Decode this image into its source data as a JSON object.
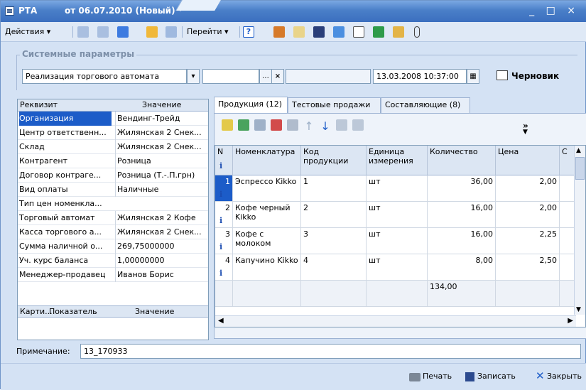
{
  "window": {
    "title_app": "РТА",
    "title_doc": "от 06.07.2010 (Новый) *",
    "controls": "_ □ ×"
  },
  "toolbar": {
    "actions_label": "Действия ▾",
    "goto_label": "Перейти ▾",
    "help_glyph": "?"
  },
  "system_params": {
    "legend": "Системные параметры",
    "operation_type": "Реализация торгового автомата",
    "ellipsis": "...",
    "clear": "×",
    "date_value": "13.03.2008 10:37:00",
    "draft_label": "Черновик"
  },
  "requisites": {
    "headers": [
      "Реквизит",
      "Значение"
    ],
    "rows": [
      [
        "Организация",
        "Вендинг-Трейд"
      ],
      [
        "Центр ответственн...",
        "Жилянская 2 Снек..."
      ],
      [
        "Склад",
        "Жилянская 2 Снек..."
      ],
      [
        "Контрагент",
        "Розница"
      ],
      [
        "Договор контраге...",
        "Розница (Т.-.П.грн)"
      ],
      [
        "Вид оплаты",
        "Наличные"
      ],
      [
        "Тип цен номенкла...",
        ""
      ],
      [
        "Торговый автомат",
        "Жилянская 2 Кофе"
      ],
      [
        "Касса торгового а...",
        "Жилянская 2 Снек..."
      ],
      [
        "Сумма наличной о...",
        "269,75000000"
      ],
      [
        "Уч. курс баланса",
        "1,00000000"
      ],
      [
        "Менеджер-продавец",
        "Иванов Борис"
      ]
    ],
    "subheaders": [
      "Карти...",
      "Показатель",
      "Значение"
    ]
  },
  "tabs": [
    "Продукция (12)",
    "Тестовые продажи",
    "Составляющие (8)"
  ],
  "more_glyph": "»",
  "products": {
    "headers": [
      "N",
      "Номенклатура",
      "Код продукции",
      "Единица измерения",
      "Количество",
      "Цена",
      "С"
    ],
    "rows": [
      {
        "n": "1",
        "name": "Эспрессо Kikko",
        "code": "1",
        "unit": "шт",
        "qty": "36,00",
        "price": "2,00"
      },
      {
        "n": "2",
        "name": "Кофе черный Kikko",
        "code": "2",
        "unit": "шт",
        "qty": "16,00",
        "price": "2,00"
      },
      {
        "n": "3",
        "name": "Кофе с молоком",
        "code": "3",
        "unit": "шт",
        "qty": "16,00",
        "price": "2,25"
      },
      {
        "n": "4",
        "name": "Капучино Kikko",
        "code": "4",
        "unit": "шт",
        "qty": "8,00",
        "price": "2,50"
      }
    ],
    "total_qty": "134,00",
    "info_glyph": "i"
  },
  "note": {
    "label": "Примечание:",
    "value": "13_170933"
  },
  "status": {
    "print": "Печать",
    "save": "Записать",
    "close": "Закрыть"
  },
  "colors": {
    "title_gradient_top": "#7aa7e2",
    "title_gradient_bottom": "#3b6fbf",
    "selection": "#1c5cc8",
    "panel_bg": "#d4e2f4"
  }
}
